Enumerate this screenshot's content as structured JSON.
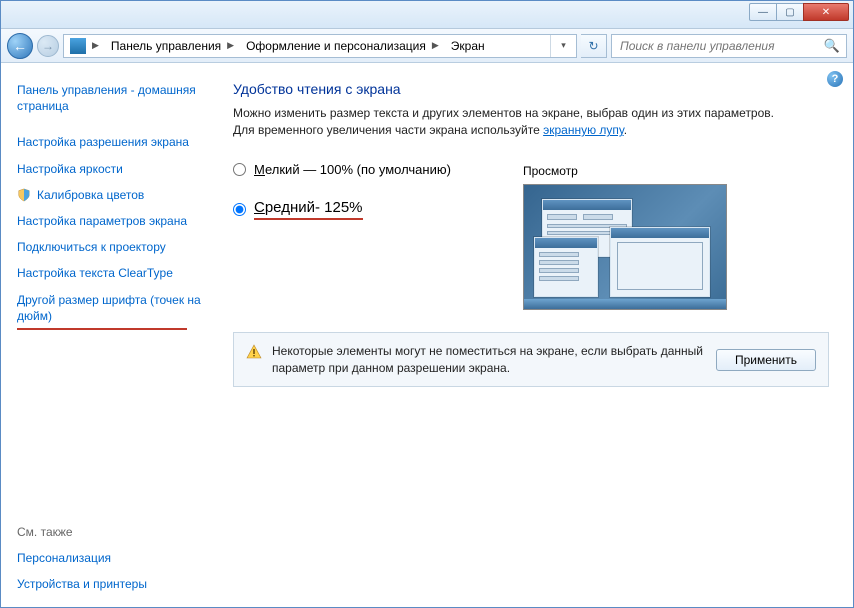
{
  "titlebar": {
    "minimize": "—",
    "maximize": "▢",
    "close": "✕"
  },
  "nav": {
    "back": "←",
    "forward": "→",
    "breadcrumbs": [
      "Панель управления",
      "Оформление и персонализация",
      "Экран"
    ],
    "refresh": "↻",
    "search_placeholder": "Поиск в панели управления"
  },
  "sidebar": {
    "home": "Панель управления - домашняя страница",
    "items": [
      "Настройка разрешения экрана",
      "Настройка яркости",
      "Калибровка цветов",
      "Настройка параметров экрана",
      "Подключиться к проектору",
      "Настройка текста ClearType",
      "Другой размер шрифта (точек на дюйм)"
    ],
    "see_also_label": "См. также",
    "see_also": [
      "Персонализация",
      "Устройства и принтеры"
    ]
  },
  "content": {
    "heading": "Удобство чтения с экрана",
    "desc_before": "Можно изменить размер текста и других элементов на экране, выбрав один из этих параметров. Для временного увеличения части экрана используйте ",
    "desc_link": "экранную лупу",
    "desc_after": ".",
    "opt_small_underline": "М",
    "opt_small_rest": "елкий — 100% (по умолчанию)",
    "opt_medium_underline": "С",
    "opt_medium_rest": "редний- 125%",
    "preview_label": "Просмотр",
    "info_text": "Некоторые элементы могут не поместиться на экране, если выбрать данный параметр при данном разрешении экрана.",
    "apply": "Применить",
    "help": "?"
  }
}
